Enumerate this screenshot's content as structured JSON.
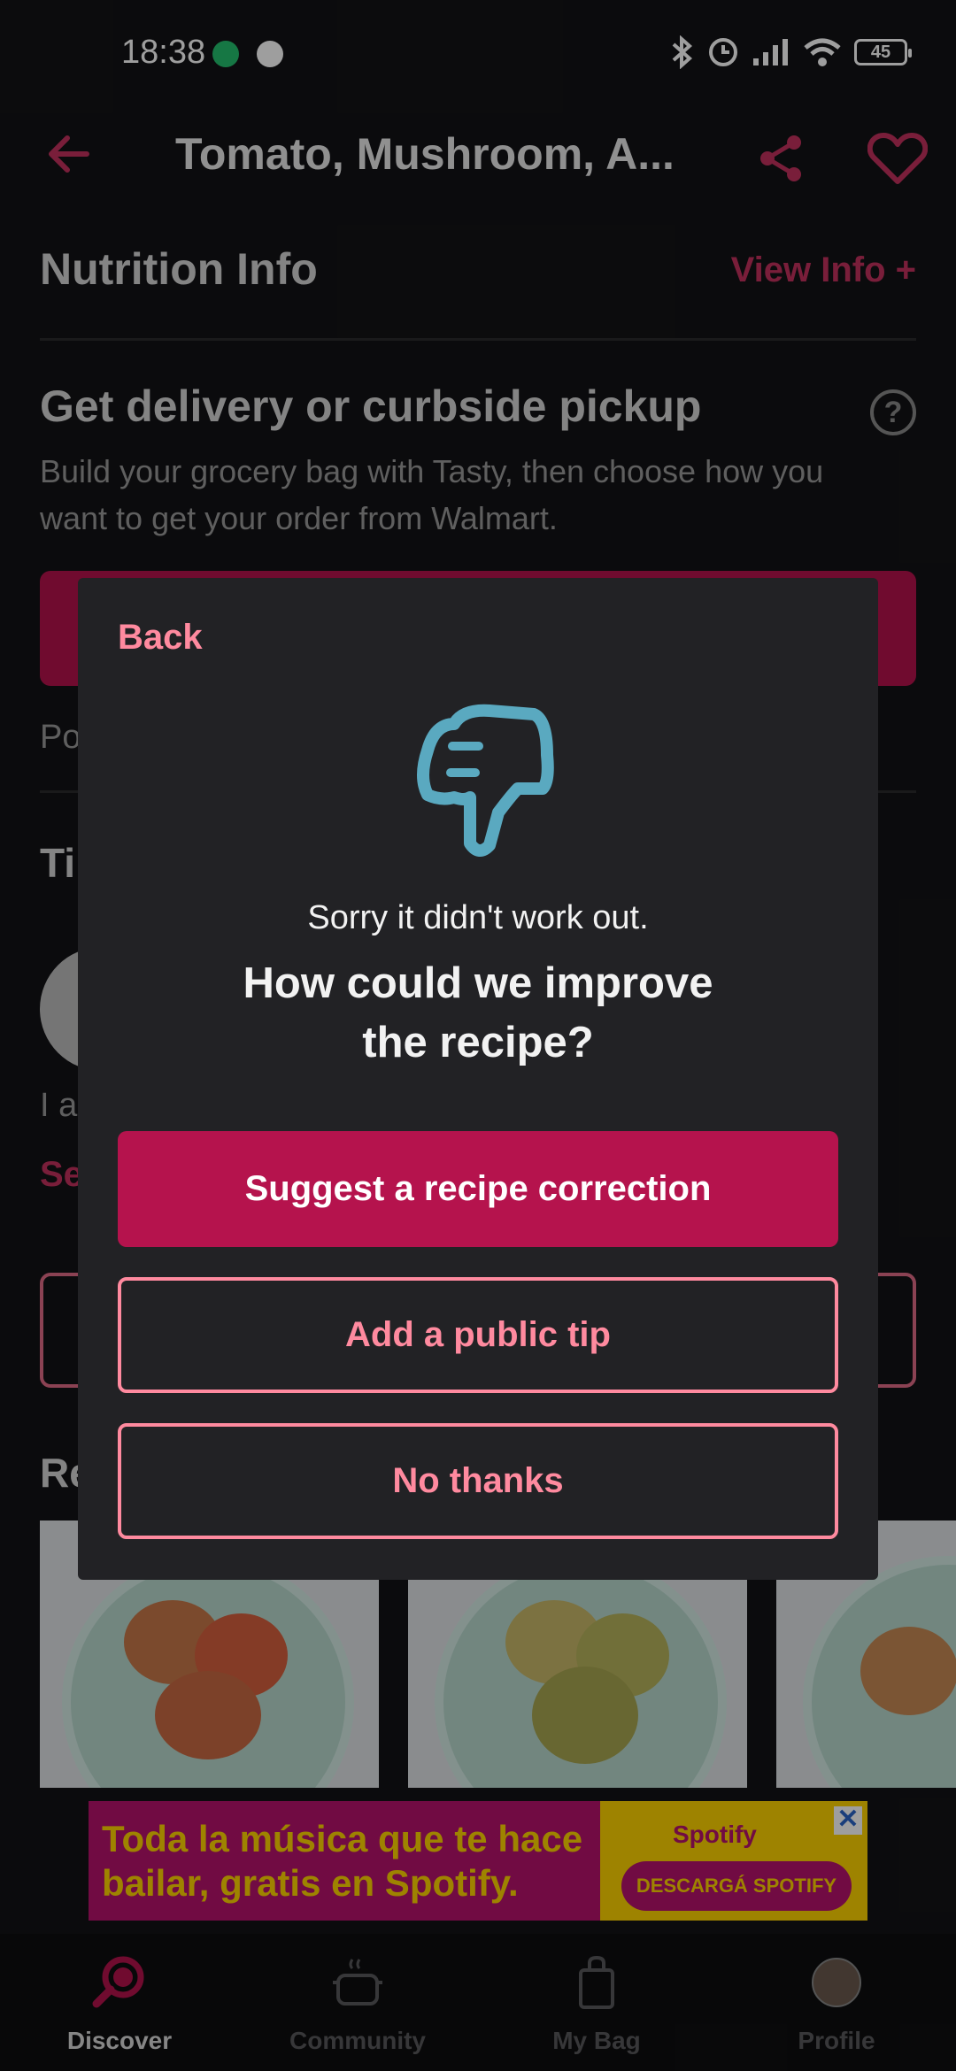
{
  "status_bar": {
    "time": "18:38",
    "battery": "45"
  },
  "header": {
    "title": "Tomato, Mushroom, A..."
  },
  "nutrition": {
    "label": "Nutrition Info",
    "link": "View Info +"
  },
  "delivery": {
    "heading": "Get delivery or curbside pickup",
    "body": "Build your grocery bag with Tasty, then choose how you want to get your order from Walmart."
  },
  "peeks": {
    "po": "Po",
    "ti": "Ti",
    "i_a": "I a",
    "se": "Se",
    "re": "Re"
  },
  "modal": {
    "back_label": "Back",
    "sorry_text": "Sorry it didn't work out.",
    "question": "How could we improve the recipe?",
    "suggest_label": "Suggest a recipe correction",
    "tip_label": "Add a public tip",
    "no_thanks_label": "No thanks"
  },
  "ad": {
    "headline": "Toda la música que te hace bailar, gratis en Spotify.",
    "brand": "Spotify",
    "cta": "DESCARGÁ SPOTIFY",
    "close": "✕"
  },
  "bottom_nav": {
    "items": [
      {
        "label": "Discover",
        "icon": "search-icon",
        "active": true
      },
      {
        "label": "Community",
        "icon": "pot-icon",
        "active": false
      },
      {
        "label": "My Bag",
        "icon": "bag-icon",
        "active": false
      },
      {
        "label": "Profile",
        "icon": "avatar",
        "active": false
      }
    ]
  },
  "colors": {
    "accent": "#b5134d",
    "accent_light": "#ff8a9f",
    "icon_teal": "#5aa9c0",
    "modal_bg": "#222225",
    "ad_purple": "#b6126d",
    "ad_yellow": "#ffd400"
  }
}
